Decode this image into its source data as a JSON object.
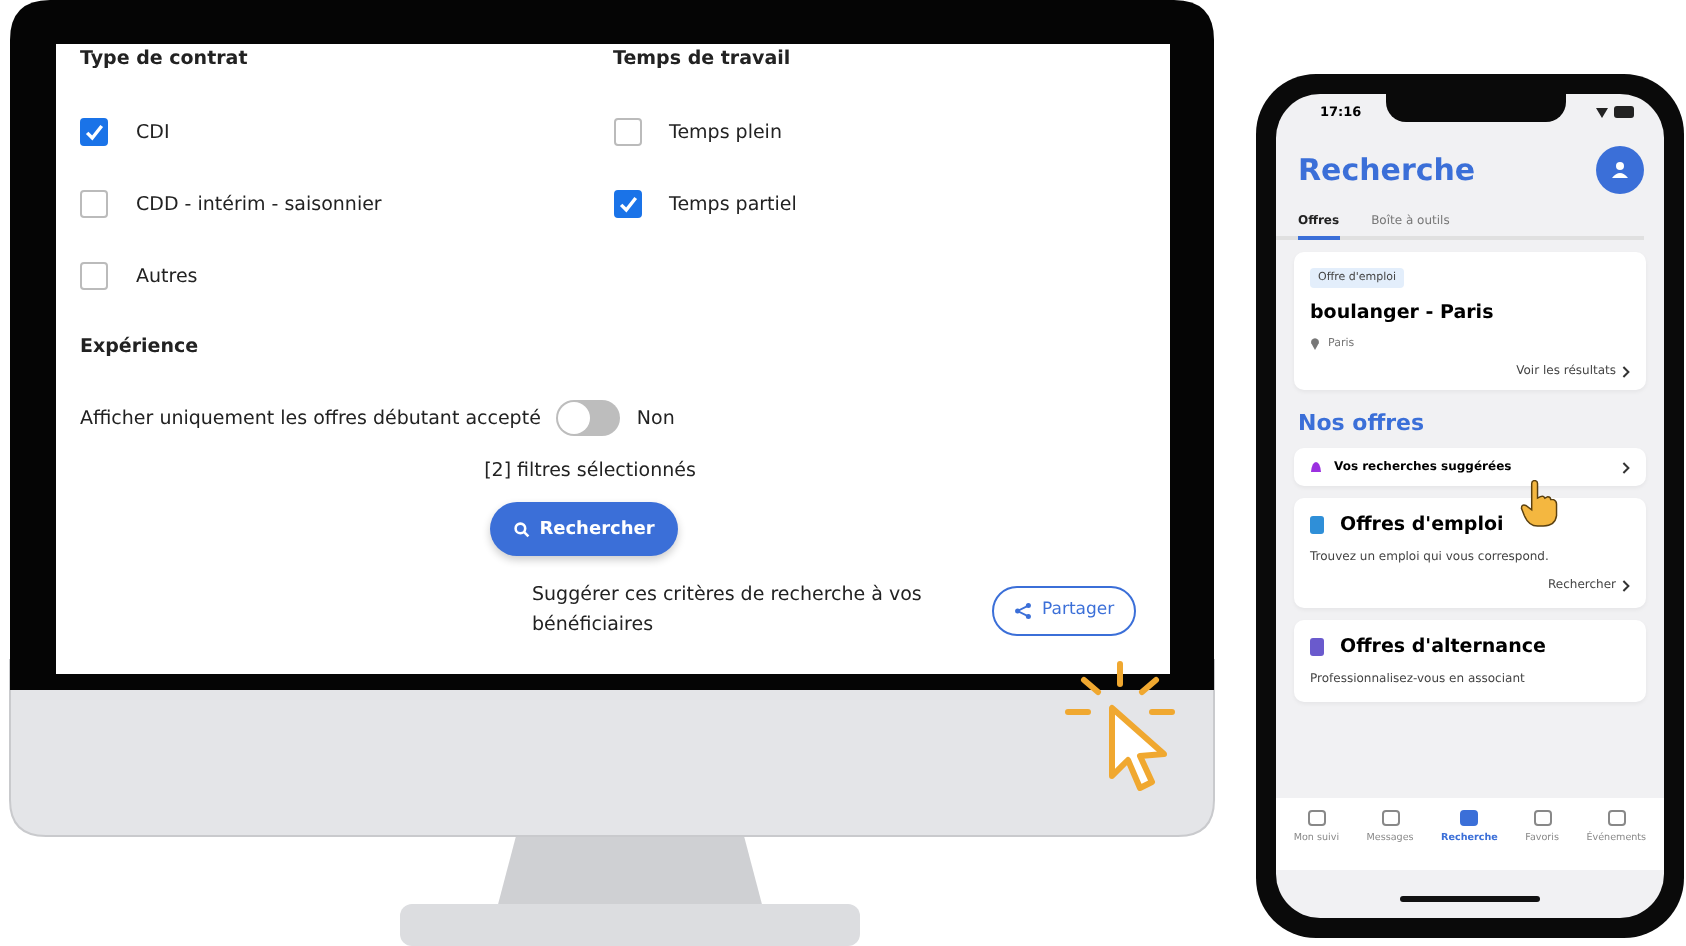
{
  "desktop": {
    "contract": {
      "title": "Type de contrat",
      "options": [
        {
          "label": "CDI",
          "checked": true
        },
        {
          "label": "CDD - intérim - saisonnier",
          "checked": false
        },
        {
          "label": "Autres",
          "checked": false
        }
      ]
    },
    "work_time": {
      "title": "Temps de travail",
      "options": [
        {
          "label": "Temps plein",
          "checked": false
        },
        {
          "label": "Temps partiel",
          "checked": true
        }
      ]
    },
    "experience": {
      "title": "Expérience",
      "toggle_label": "Afficher uniquement les offres débutant accepté",
      "on": false,
      "state_text": "Non"
    },
    "filters_count": "[2] filtres sélectionnés",
    "search_button": "Rechercher",
    "share": {
      "text": "Suggérer ces critères de recherche à vos bénéficiaires",
      "button": "Partager"
    }
  },
  "phone": {
    "time": "17:16",
    "title": "Recherche",
    "tabs": [
      {
        "label": "Offres",
        "selected": true
      },
      {
        "label": "Boîte à outils",
        "selected": false
      }
    ],
    "search_card": {
      "tag": "Offre d'emploi",
      "title": "boulanger - Paris",
      "location": "Paris",
      "link": "Voir les résultats"
    },
    "section_title": "Nos offres",
    "suggestions": "Vos recherches suggérées",
    "cards": [
      {
        "title": "Offres d'emploi",
        "text": "Trouvez un emploi qui vous correspond.",
        "link": "Rechercher",
        "color": "#2f8fd8"
      },
      {
        "title": "Offres d'alternance",
        "text": "Professionnalisez-vous en associant",
        "color": "#6a5acd"
      }
    ],
    "nav": [
      {
        "label": "Mon suivi",
        "selected": false
      },
      {
        "label": "Messages",
        "selected": false
      },
      {
        "label": "Recherche",
        "selected": true
      },
      {
        "label": "Favoris",
        "selected": false
      },
      {
        "label": "Événements",
        "selected": false
      }
    ]
  }
}
